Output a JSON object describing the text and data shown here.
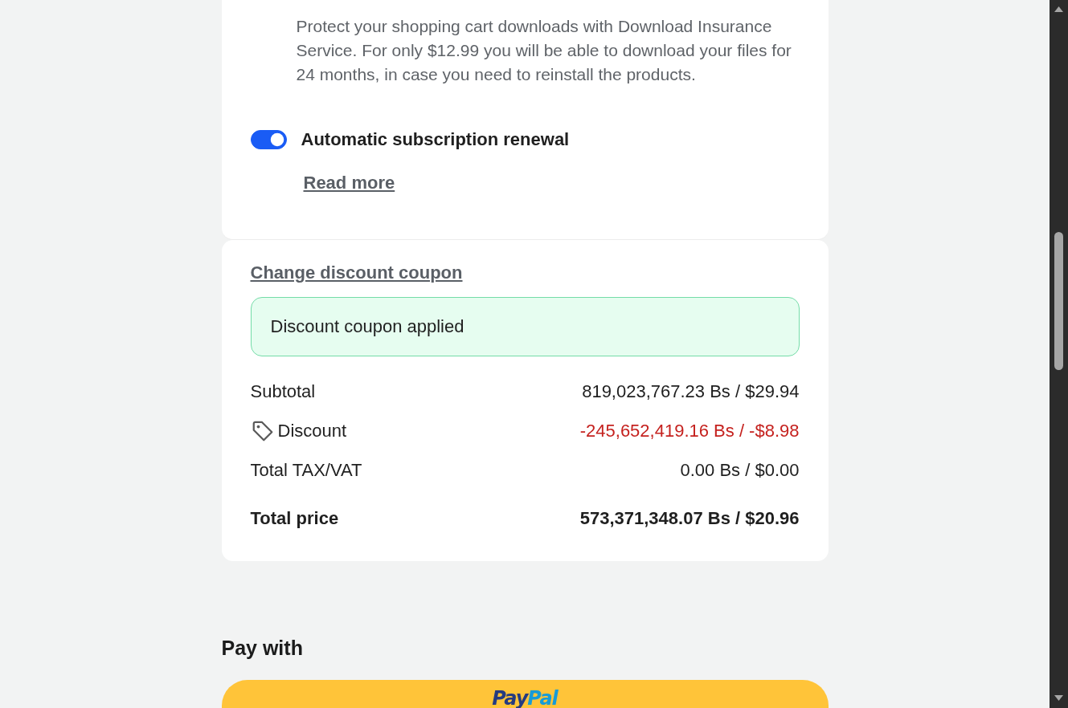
{
  "insurance": {
    "description": "Protect your shopping cart downloads with Download Insurance Service. For only $12.99 you will be able to download your files for 24 months, in case you need to reinstall the products."
  },
  "renewal": {
    "label": "Automatic subscription renewal",
    "on": true,
    "link": "Read more"
  },
  "coupon": {
    "change_link": "Change discount coupon",
    "status": "Discount coupon applied"
  },
  "summary": [
    {
      "kind": "plain",
      "label": "Subtotal",
      "value": "819,023,767.23 Bs / $29.94"
    },
    {
      "kind": "discount",
      "label": "Discount",
      "value": "-245,652,419.16 Bs / -$8.98"
    },
    {
      "kind": "plain",
      "label": "Total TAX/VAT",
      "value": "0.00 Bs / $0.00"
    },
    {
      "kind": "total",
      "label": "Total price",
      "value": "573,371,348.07 Bs / $20.96"
    }
  ],
  "payment": {
    "heading": "Pay with",
    "paypal_logo": [
      "Pay",
      "Pal"
    ]
  }
}
